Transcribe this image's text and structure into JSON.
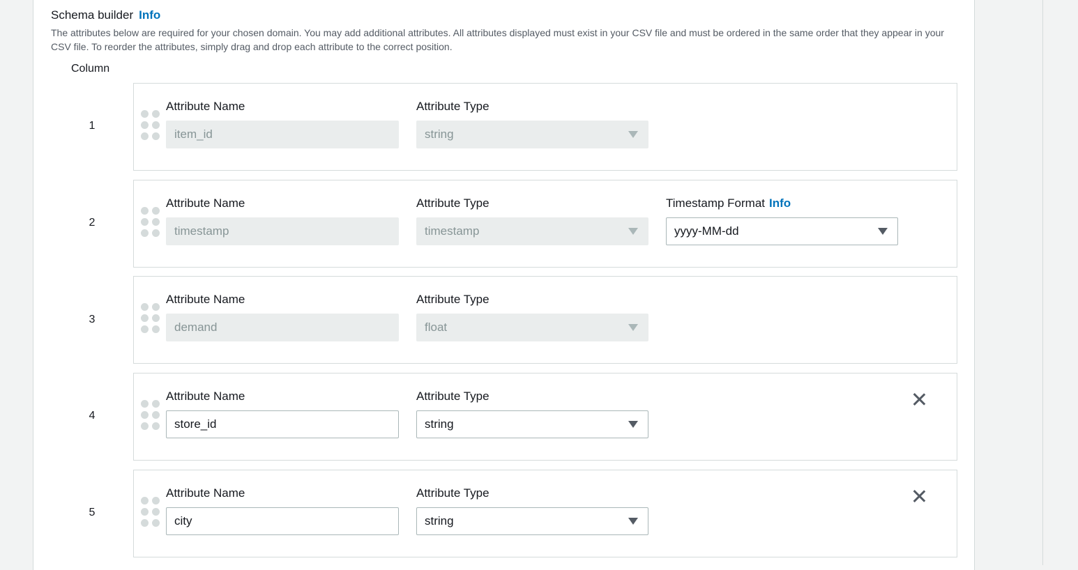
{
  "header": {
    "title": "Schema builder",
    "info_link": "Info",
    "description": "The attributes below are required for your chosen domain. You may add additional attributes. All attributes displayed must exist in your CSV file and must be ordered in the same order that they appear in your CSV file. To reorder the attributes, simply drag and drop each attribute to the correct position."
  },
  "column_label": "Column",
  "attributes": [
    {
      "index": "1",
      "name_label": "Attribute Name",
      "name_value": "item_id",
      "type_label": "Attribute Type",
      "type_value": "string",
      "editable": false
    },
    {
      "index": "2",
      "name_label": "Attribute Name",
      "name_value": "timestamp",
      "type_label": "Attribute Type",
      "type_value": "timestamp",
      "editable": false,
      "timestamp_format_label": "Timestamp Format",
      "timestamp_info_link": "Info",
      "timestamp_format_value": "yyyy-MM-dd"
    },
    {
      "index": "3",
      "name_label": "Attribute Name",
      "name_value": "demand",
      "type_label": "Attribute Type",
      "type_value": "float",
      "editable": false
    },
    {
      "index": "4",
      "name_label": "Attribute Name",
      "name_value": "store_id",
      "type_label": "Attribute Type",
      "type_value": "string",
      "editable": true,
      "removable": true
    },
    {
      "index": "5",
      "name_label": "Attribute Name",
      "name_value": "city",
      "type_label": "Attribute Type",
      "type_value": "string",
      "editable": true,
      "removable": true
    }
  ],
  "icons": {
    "drag": "drag-handle-icon",
    "caret": "caret-down-icon",
    "remove": "close-icon"
  },
  "colors": {
    "link": "#0073bb",
    "border": "#d5dbdb",
    "disabled_bg": "#eaeded"
  }
}
